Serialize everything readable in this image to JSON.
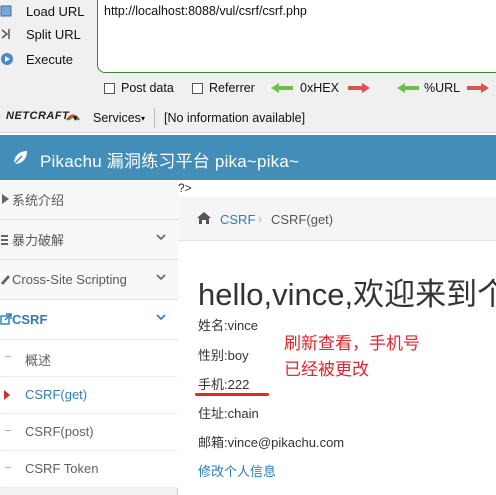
{
  "hackbar": {
    "load_url": "Load URL",
    "split_url": "Split URL",
    "execute": "Execute",
    "url_value": "http://localhost:8088/vul/csrf/csrf.php",
    "post_data": "Post data",
    "referrer": "Referrer",
    "hex": "0xHEX",
    "url_encode": "%URL"
  },
  "toolbar": {
    "netcraft": "NETCRAFT",
    "services": "Services",
    "info": "[No information available]"
  },
  "header": {
    "title": "Pikachu 漏洞练习平台 pika~pika~"
  },
  "stray_text": "?>",
  "sidebar": {
    "items": [
      {
        "label": "系统介绍"
      },
      {
        "label": "暴力破解"
      },
      {
        "label": "Cross-Site Scripting"
      },
      {
        "label": "CSRF"
      }
    ],
    "sub_items": [
      {
        "label": "概述"
      },
      {
        "label": "CSRF(get)"
      },
      {
        "label": "CSRF(post)"
      },
      {
        "label": "CSRF Token"
      }
    ]
  },
  "breadcrumb": {
    "section": "CSRF",
    "page": "CSRF(get)"
  },
  "main": {
    "greeting": "hello,vince,欢迎来到个",
    "name": "姓名:vince",
    "gender": "性别:boy",
    "phone": "手机:222",
    "address": "住址:chain",
    "email": "邮箱:vince@pikachu.com",
    "edit_link": "修改个人信息"
  },
  "annotation": {
    "line1": "刷新查看，手机号",
    "line2": "已经被更改"
  },
  "colors": {
    "header_blue": "#438eb9",
    "link_blue": "#2b7dbc",
    "annotation_red": "#e4262e"
  }
}
